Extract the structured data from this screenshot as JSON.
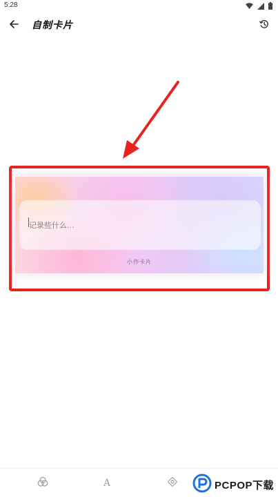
{
  "status_bar": {
    "time": "5:28",
    "icons": [
      "wifi-icon",
      "signal-icon",
      "battery-icon"
    ]
  },
  "app_bar": {
    "title": "自制卡片",
    "back_icon": "arrow-left-icon",
    "history_icon": "history-icon"
  },
  "card": {
    "placeholder": "记录些什么...",
    "value": "",
    "footer": "小作卡片"
  },
  "toolbar": {
    "items": [
      {
        "icon": "palette-icon"
      },
      {
        "icon": "text-style-icon",
        "glyph": "A"
      },
      {
        "icon": "sticker-icon"
      }
    ]
  },
  "watermark": {
    "text": "PCPOP下载",
    "logo_icon": "pcpop-logo-icon"
  },
  "colors": {
    "highlight": "#e8231f",
    "arrow": "#e8231f",
    "background": "#ffffff"
  }
}
